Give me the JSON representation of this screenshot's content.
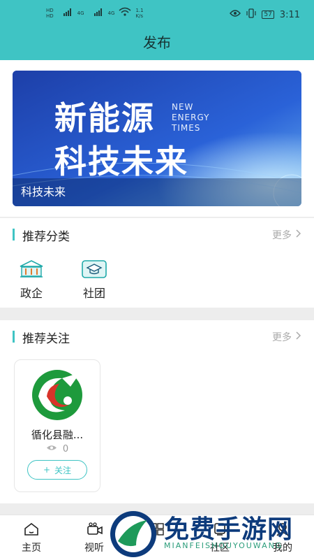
{
  "status": {
    "net_label_1": "HD",
    "net_label_2": "HD",
    "sig_1": "4G",
    "sig_2": "4G",
    "speed_top": "1.1",
    "speed_bottom": "K/s",
    "battery": "57",
    "time": "3:11"
  },
  "header": {
    "title": "发布"
  },
  "banner": {
    "line1": "新能源",
    "line2": "科技未来",
    "en1": "NEW",
    "en2": "ENERGY",
    "en3": "TIMES",
    "caption": "科技未来"
  },
  "recommend_category": {
    "title": "推荐分类",
    "more": "更多",
    "items": [
      {
        "label": "政企",
        "icon": "government-building-icon"
      },
      {
        "label": "社团",
        "icon": "graduation-cap-icon"
      }
    ]
  },
  "recommend_follow": {
    "title": "推荐关注",
    "more": "更多",
    "cards": [
      {
        "name": "循化县融...",
        "views": "0",
        "follow_label": "关注",
        "follow_symbol": "+"
      }
    ]
  },
  "tabbar": {
    "items": [
      {
        "label": "主页",
        "icon": "home-icon"
      },
      {
        "label": "视听",
        "icon": "video-icon"
      },
      {
        "label": "",
        "icon": "center-icon"
      },
      {
        "label": "社区",
        "icon": "community-icon"
      },
      {
        "label": "我的",
        "icon": "profile-icon"
      }
    ]
  },
  "watermark": {
    "text": "免费手游网",
    "sub": "MIANFEISHOUYOUWANG"
  },
  "colors": {
    "accent": "#3fc4c4",
    "banner": "#1d4fc4",
    "watermark": "#0d3b7c"
  }
}
